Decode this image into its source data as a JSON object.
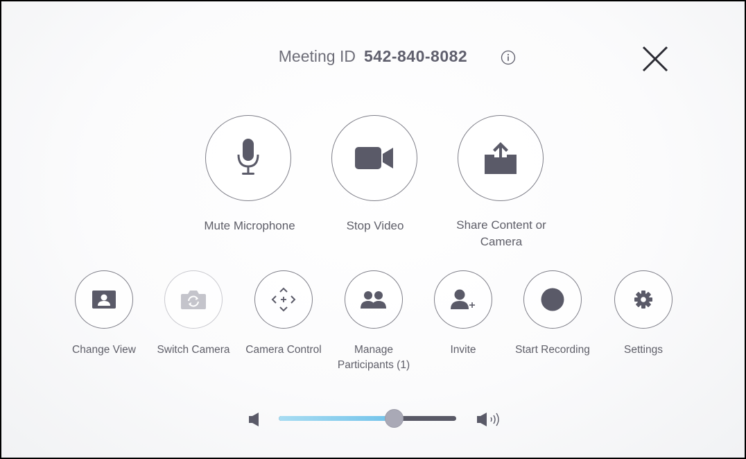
{
  "header": {
    "meeting_id_label": "Meeting ID",
    "meeting_id_value": "542-840-8082",
    "info_icon": "info-icon",
    "close_icon": "close-icon"
  },
  "primary_actions": [
    {
      "label": "Mute Microphone",
      "icon": "microphone-icon"
    },
    {
      "label": "Stop Video",
      "icon": "video-camera-icon"
    },
    {
      "label_line1": "Share Content or",
      "label_line2": "Camera",
      "icon": "share-upload-icon"
    }
  ],
  "secondary_actions": [
    {
      "label": "Change View",
      "icon": "change-view-icon"
    },
    {
      "label": "Switch Camera",
      "icon": "switch-camera-icon",
      "disabled": true
    },
    {
      "label": "Camera Control",
      "icon": "camera-control-icon"
    },
    {
      "label_line1": "Manage",
      "label_line2": "Participants (1)",
      "icon": "participants-icon"
    },
    {
      "label": "Invite",
      "icon": "invite-user-icon"
    },
    {
      "label": "Start Recording",
      "icon": "record-icon"
    },
    {
      "label": "Settings",
      "icon": "gear-icon"
    }
  ],
  "volume": {
    "level": 0.65,
    "low_icon": "speaker-low-icon",
    "high_icon": "speaker-high-icon"
  },
  "colors": {
    "icon": "#5a5a68",
    "icon_disabled": "#c4c4cb",
    "circle_border": "#7e7e88",
    "slider_fill": "#72c3ea",
    "slider_track": "#595966",
    "slider_thumb": "#a9a9b6"
  }
}
